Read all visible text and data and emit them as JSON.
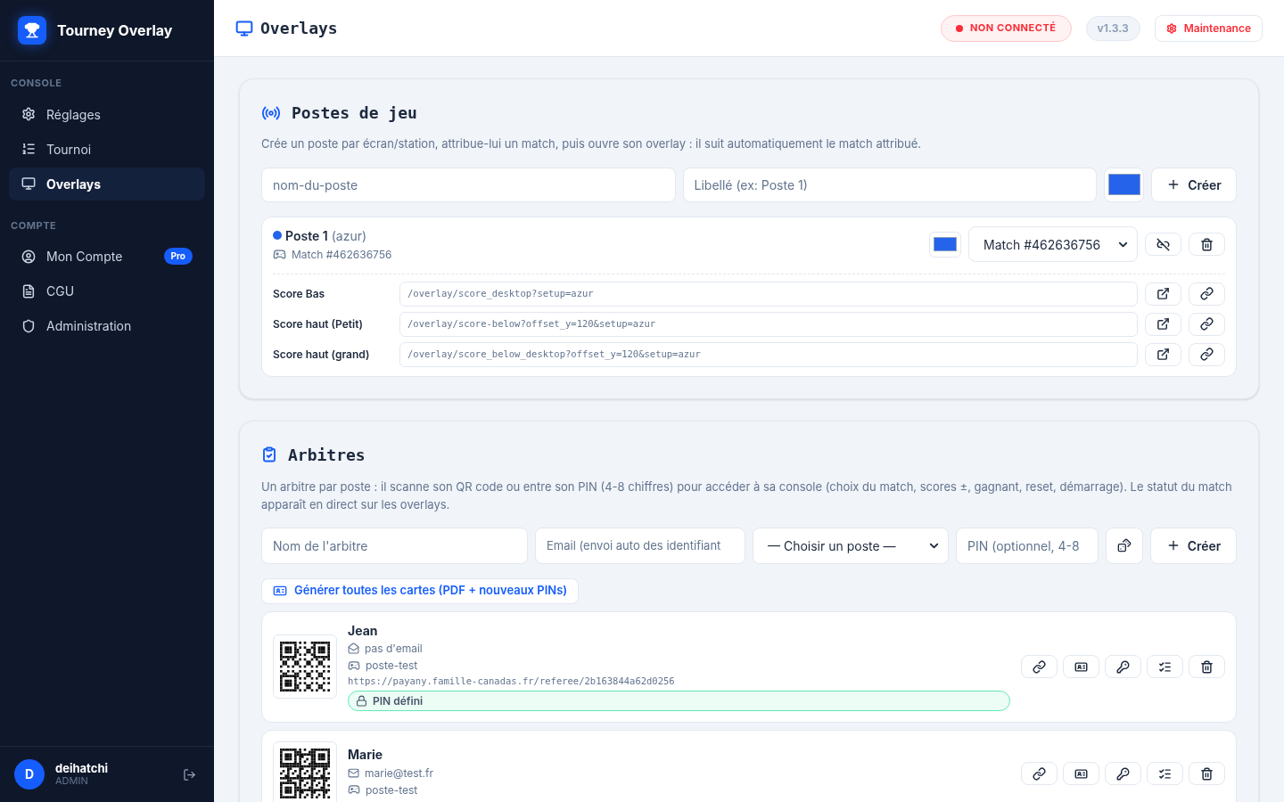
{
  "sidebar": {
    "brand": "Tourney Overlay",
    "sections": [
      {
        "title": "CONSOLE",
        "items": [
          {
            "label": "Réglages",
            "selected": false
          },
          {
            "label": "Tournoi",
            "selected": false
          },
          {
            "label": "Overlays",
            "selected": true
          }
        ]
      },
      {
        "title": "COMPTE",
        "items": [
          {
            "label": "Mon Compte",
            "selected": false,
            "badge": "Pro"
          },
          {
            "label": "CGU",
            "selected": false
          },
          {
            "label": "Administration",
            "selected": false
          }
        ]
      }
    ],
    "user": {
      "initial": "D",
      "name": "deihatchi",
      "role": "ADMIN"
    }
  },
  "header": {
    "title": "Overlays",
    "status": "NON CONNECTÉ",
    "version": "v1.3.3",
    "maintenance": "Maintenance"
  },
  "postes": {
    "title": "Postes de jeu",
    "description": "Crée un poste par écran/station, attribue-lui un match, puis ouvre son overlay : il suit automatiquement le match attribué.",
    "form": {
      "name_placeholder": "nom-du-poste",
      "label_placeholder": "Libellé (ex: Poste 1)",
      "color": "#2563eb",
      "create": "Créer"
    },
    "items": [
      {
        "name": "Poste 1",
        "slug": "(azur)",
        "color": "#2563eb",
        "match": "Match #462636756",
        "selected_match": "Match #462636756",
        "links": [
          {
            "label": "Score Bas",
            "url": "/overlay/score_desktop?setup=azur"
          },
          {
            "label": "Score haut (Petit)",
            "url": "/overlay/score-below?offset_y=120&setup=azur"
          },
          {
            "label": "Score haut (grand)",
            "url": "/overlay/score_below_desktop?offset_y=120&setup=azur"
          }
        ]
      }
    ]
  },
  "arbitres": {
    "title": "Arbitres",
    "description": "Un arbitre par poste : il scanne son QR code ou entre son PIN (4-8 chiffres) pour accéder à sa console (choix du match, scores ±, gagnant, reset, démarrage). Le statut du match apparaît en direct sur les overlays.",
    "form": {
      "name_placeholder": "Nom de l'arbitre",
      "email_placeholder": "Email (envoi auto des identifiant",
      "poste_select": "— Choisir un poste —",
      "pin_placeholder": "PIN (optionnel, 4-8",
      "create": "Créer"
    },
    "generate": "Générer toutes les cartes (PDF + nouveaux PINs)",
    "referees": [
      {
        "name": "Jean",
        "email": "pas d'email",
        "has_email": false,
        "poste": "poste-test",
        "url": "https://payany.famille-canadas.fr/referee/2b163844a62d0256",
        "pin": "PIN défini"
      },
      {
        "name": "Marie",
        "email": "marie@test.fr",
        "has_email": true,
        "poste": "poste-test"
      }
    ]
  }
}
